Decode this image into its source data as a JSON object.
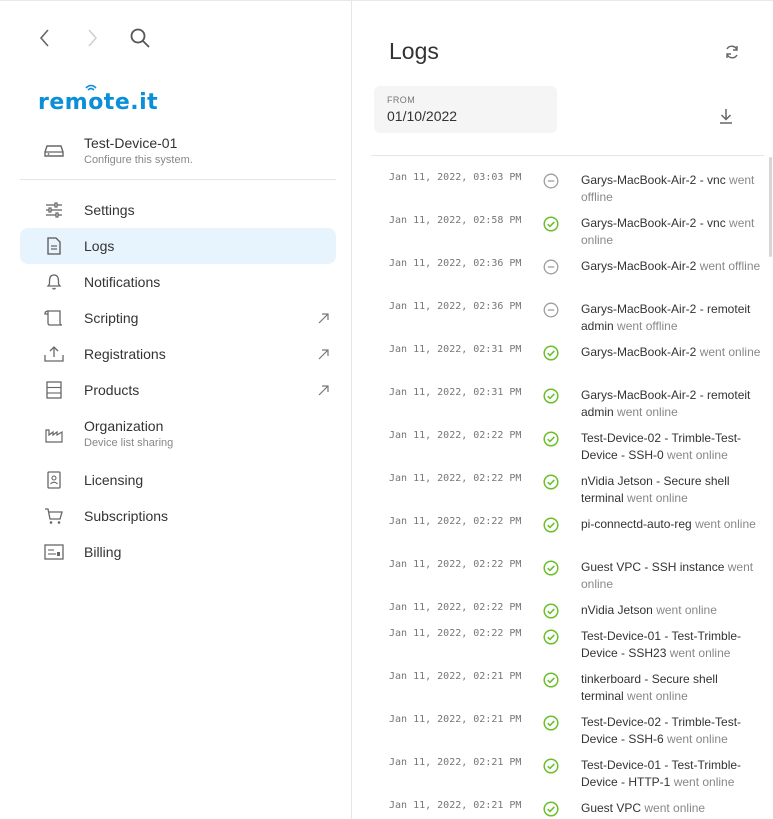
{
  "app": {
    "logo_text": "remote.it",
    "brand_color": "#0a8fd8"
  },
  "device": {
    "name": "Test-Device-01",
    "subtitle": "Configure this system."
  },
  "menu": [
    {
      "label": "Settings",
      "icon": "sliders-icon"
    },
    {
      "label": "Logs",
      "icon": "document-icon",
      "active": true
    },
    {
      "label": "Notifications",
      "icon": "bell-icon"
    },
    {
      "label": "Scripting",
      "icon": "scroll-icon",
      "external": true
    },
    {
      "label": "Registrations",
      "icon": "upload-tray-icon",
      "external": true
    },
    {
      "label": "Products",
      "icon": "server-icon",
      "external": true
    },
    {
      "label": "Organization",
      "subtitle": "Device list sharing",
      "icon": "industry-icon"
    },
    {
      "label": "Licensing",
      "icon": "id-badge-icon"
    },
    {
      "label": "Subscriptions",
      "icon": "cart-icon"
    },
    {
      "label": "Billing",
      "icon": "invoice-icon"
    }
  ],
  "main": {
    "title": "Logs",
    "from_label": "FROM",
    "from_value": "01/10/2022"
  },
  "logs": [
    {
      "time": "Jan 11, 2022, 03:03 PM",
      "status": "offline",
      "name": "Garys-MacBook-Air-2 - vnc",
      "event": "went offline"
    },
    {
      "time": "Jan 11, 2022, 02:58 PM",
      "status": "online",
      "name": "Garys-MacBook-Air-2 - vnc",
      "event": "went online"
    },
    {
      "time": "Jan 11, 2022, 02:36 PM",
      "status": "offline",
      "name": "Garys-MacBook-Air-2",
      "event": "went offline"
    },
    {
      "time": "Jan 11, 2022, 02:36 PM",
      "status": "offline",
      "name": "Garys-MacBook-Air-2 - remoteit admin",
      "event": "went offline"
    },
    {
      "time": "Jan 11, 2022, 02:31 PM",
      "status": "online",
      "name": "Garys-MacBook-Air-2",
      "event": "went online"
    },
    {
      "time": "Jan 11, 2022, 02:31 PM",
      "status": "online",
      "name": "Garys-MacBook-Air-2 - remoteit admin",
      "event": "went online"
    },
    {
      "time": "Jan 11, 2022, 02:22 PM",
      "status": "online",
      "name": "Test-Device-02 - Trimble-Test-Device - SSH-0",
      "event": "went online"
    },
    {
      "time": "Jan 11, 2022, 02:22 PM",
      "status": "online",
      "name": "nVidia Jetson - Secure shell terminal",
      "event": "went online"
    },
    {
      "time": "Jan 11, 2022, 02:22 PM",
      "status": "online",
      "name": "pi-connectd-auto-reg",
      "event": "went online"
    },
    {
      "time": "Jan 11, 2022, 02:22 PM",
      "status": "online",
      "name": "Guest VPC - SSH instance",
      "event": "went online"
    },
    {
      "time": "Jan 11, 2022, 02:22 PM",
      "status": "online",
      "name": "nVidia Jetson",
      "event": "went online"
    },
    {
      "time": "Jan 11, 2022, 02:22 PM",
      "status": "online",
      "name": "Test-Device-01 - Test-Trimble-Device - SSH23",
      "event": "went online"
    },
    {
      "time": "Jan 11, 2022, 02:21 PM",
      "status": "online",
      "name": "tinkerboard - Secure shell terminal",
      "event": "went online"
    },
    {
      "time": "Jan 11, 2022, 02:21 PM",
      "status": "online",
      "name": "Test-Device-02 - Trimble-Test-Device - SSH-6",
      "event": "went online"
    },
    {
      "time": "Jan 11, 2022, 02:21 PM",
      "status": "online",
      "name": "Test-Device-01 - Test-Trimble-Device - HTTP-1",
      "event": "went online"
    },
    {
      "time": "Jan 11, 2022, 02:21 PM",
      "status": "online",
      "name": "Guest VPC",
      "event": "went online"
    }
  ],
  "colors": {
    "online": "#6cbf2c",
    "offline": "#9e9e9e",
    "active_bg": "#e8f4fd"
  }
}
